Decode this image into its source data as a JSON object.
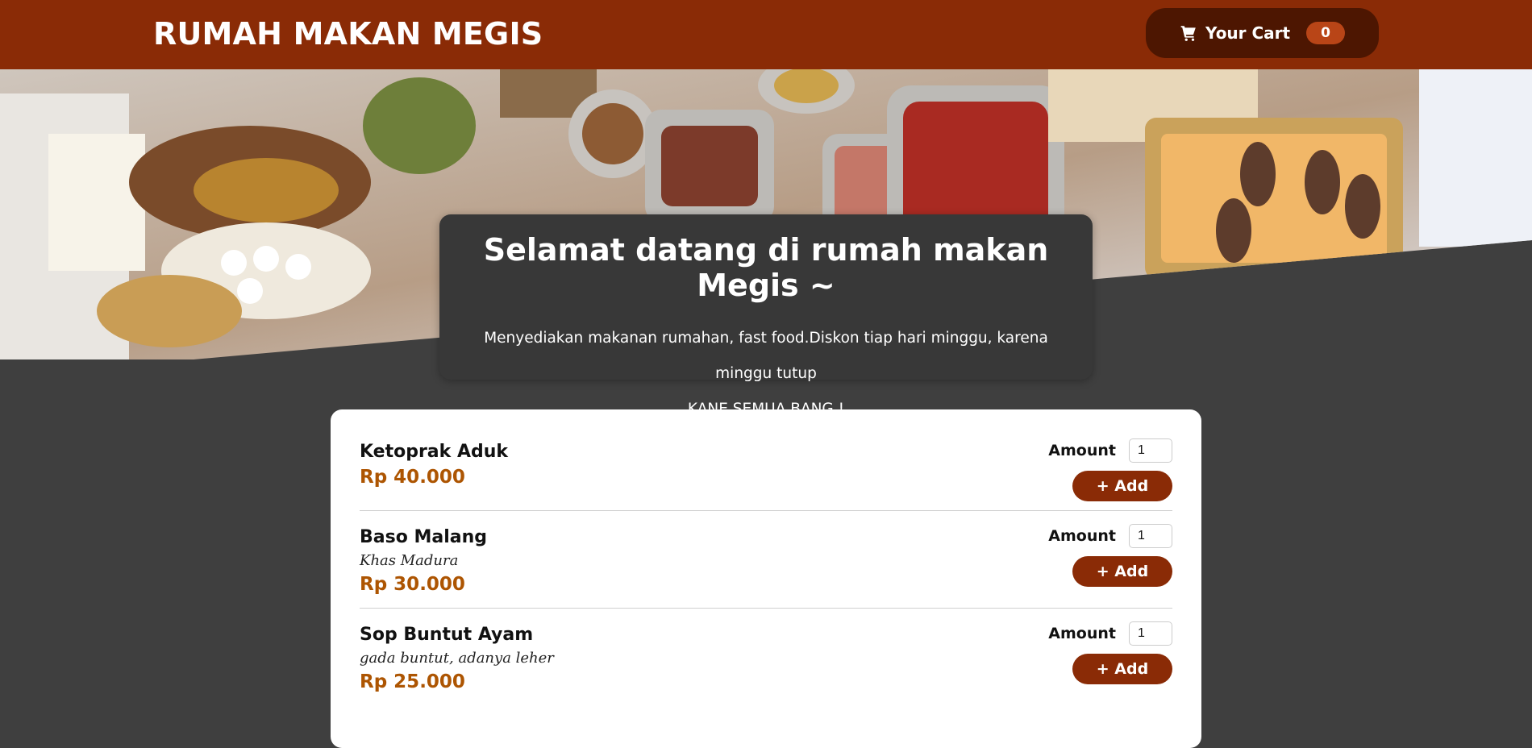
{
  "header": {
    "brand": "RUMAH MAKAN MEGIS",
    "cart_label": "Your Cart",
    "cart_count": "0"
  },
  "hero": {
    "image_alt": "buffet table of food"
  },
  "summary": {
    "title": "Selamat datang di rumah makan Megis ~",
    "line1": "Menyediakan makanan rumahan, fast food.Diskon tiap hari minggu, karena minggu tutup",
    "line2": "KANE SEMUA BANG !"
  },
  "meals": [
    {
      "name": "Ketoprak Aduk",
      "description": "",
      "price": "Rp 40.000",
      "amount_label": "Amount",
      "amount": "1",
      "add_label": "+ Add"
    },
    {
      "name": "Baso Malang",
      "description": "Khas Madura",
      "price": "Rp 30.000",
      "amount_label": "Amount",
      "amount": "1",
      "add_label": "+ Add"
    },
    {
      "name": "Sop Buntut Ayam",
      "description": "gada buntut, adanya leher",
      "price": "Rp 25.000",
      "amount_label": "Amount",
      "amount": "1",
      "add_label": "+ Add"
    }
  ],
  "colors": {
    "header": "#8a2b06",
    "cart_button": "#4d1601",
    "badge": "#b94517",
    "price": "#ad5502",
    "background": "#3f3f3f"
  },
  "icons": {
    "cart": "cart-icon"
  }
}
